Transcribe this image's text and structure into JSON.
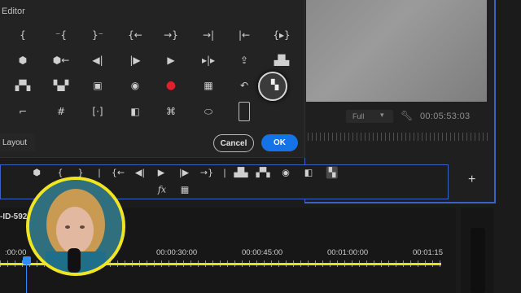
{
  "editor": {
    "title": "Editor",
    "layout_label": "Layout",
    "cancel_label": "Cancel",
    "ok_label": "OK",
    "icons": [
      {
        "name": "mark-in-icon",
        "glyph": "{"
      },
      {
        "name": "clear-in-icon",
        "glyph": "⁻{"
      },
      {
        "name": "clear-out-icon",
        "glyph": "}⁻"
      },
      {
        "name": "go-to-in-icon",
        "glyph": "{←"
      },
      {
        "name": "go-to-out-icon",
        "glyph": "→}"
      },
      {
        "name": "go-to-next-edit-icon",
        "glyph": "→|"
      },
      {
        "name": "go-to-prev-edit-icon",
        "glyph": "|←"
      },
      {
        "name": "play-in-to-out-icon",
        "glyph": "{▸}"
      },
      {
        "name": "add-marker-icon",
        "glyph": "⬢"
      },
      {
        "name": "go-to-prev-marker-icon",
        "glyph": "⬢←"
      },
      {
        "name": "step-back-icon",
        "glyph": "◀|"
      },
      {
        "name": "step-forward-icon",
        "glyph": "|▶"
      },
      {
        "name": "play-icon",
        "glyph": "▶"
      },
      {
        "name": "shuttle-icon",
        "glyph": "▸|▸"
      },
      {
        "name": "export-icon",
        "glyph": "⇪"
      },
      {
        "name": "lift-icon",
        "glyph": "▟▙"
      },
      {
        "name": "extract-icon",
        "glyph": "▞▚"
      },
      {
        "name": "insert-icon",
        "glyph": "▚▞"
      },
      {
        "name": "safe-margins-icon",
        "glyph": "▣"
      },
      {
        "name": "camera-icon",
        "glyph": "◉"
      },
      {
        "name": "record-icon",
        "glyph": "●"
      },
      {
        "name": "multicam-icon",
        "glyph": "▦"
      },
      {
        "name": "loop-icon",
        "glyph": "↶"
      },
      {
        "name": "overlay-icon",
        "glyph": "▚"
      },
      {
        "name": "trim-icon",
        "glyph": "⌐"
      },
      {
        "name": "grid-icon",
        "glyph": "#"
      },
      {
        "name": "vr-icon",
        "glyph": "[·]"
      },
      {
        "name": "comparison-icon",
        "glyph": "◧"
      },
      {
        "name": "proxy-icon",
        "glyph": "⌘"
      },
      {
        "name": "vr-headset-icon",
        "glyph": "⬭"
      },
      {
        "name": "restore-icon",
        "glyph": "▯"
      }
    ]
  },
  "monitor": {
    "zoom": "Full",
    "timecode": "00:05:53:03"
  },
  "button_bar": {
    "icons": [
      {
        "name": "marker-icon",
        "glyph": "⬢"
      },
      {
        "name": "mark-in-icon",
        "glyph": "{"
      },
      {
        "name": "mark-out-icon",
        "glyph": "}"
      },
      {
        "name": "divider-icon",
        "glyph": "|"
      },
      {
        "name": "go-to-in-icon",
        "glyph": "{←"
      },
      {
        "name": "step-back-icon",
        "glyph": "◀|"
      },
      {
        "name": "play-icon",
        "glyph": "▶"
      },
      {
        "name": "step-forward-icon",
        "glyph": "|▶"
      },
      {
        "name": "go-to-out-icon",
        "glyph": "→}"
      },
      {
        "name": "divider-icon",
        "glyph": "|"
      },
      {
        "name": "lift-icon",
        "glyph": "▟▙"
      },
      {
        "name": "extract-icon",
        "glyph": "▞▚"
      },
      {
        "name": "camera-icon",
        "glyph": "◉"
      },
      {
        "name": "comparison-icon",
        "glyph": "◧"
      },
      {
        "name": "overlay-icon",
        "glyph": "▚"
      },
      {
        "name": "fx-icon",
        "glyph": "fx"
      },
      {
        "name": "multicam-icon",
        "glyph": "▦"
      }
    ],
    "add_label": "+"
  },
  "timeline": {
    "sequence_name": "-ID-592",
    "timecodes": [
      ":00:00",
      "00:00:30:00",
      "00:00:45:00",
      "00:01:00:00",
      "00:01:15"
    ]
  }
}
